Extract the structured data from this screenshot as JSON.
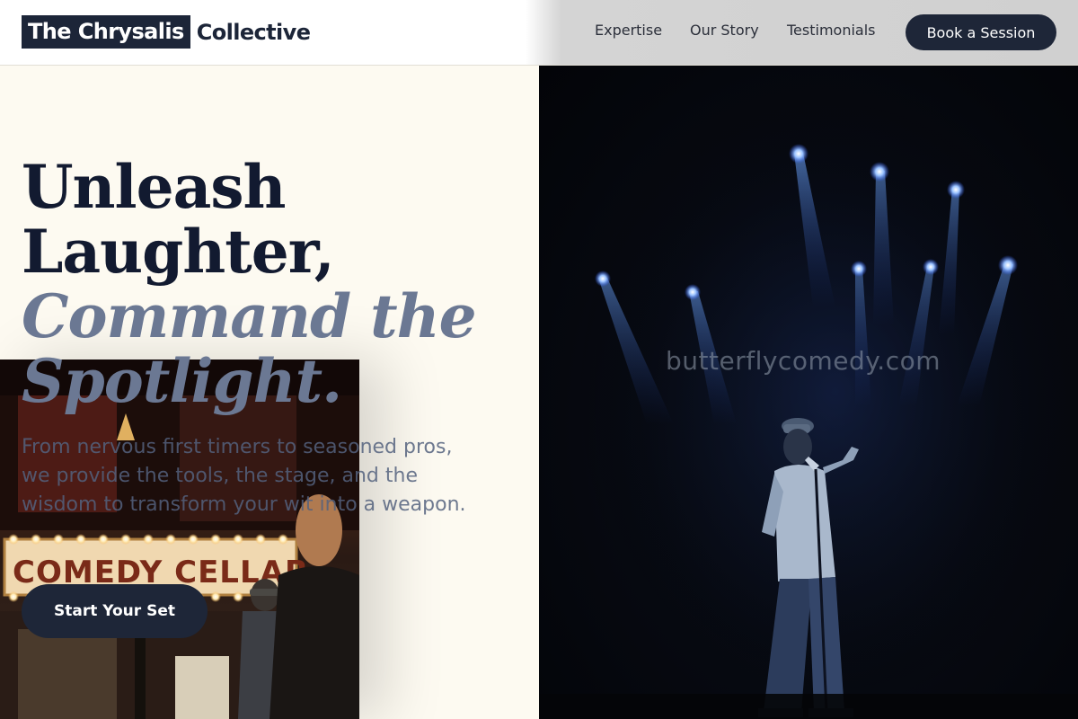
{
  "brand": {
    "name_boxed": "The Chrysalis",
    "name_rest": "Collective"
  },
  "nav": {
    "links": [
      "Expertise",
      "Our Story",
      "Testimonials"
    ],
    "cta": "Book a Session"
  },
  "hero": {
    "headline_line1": "Unleash",
    "headline_line2": "Laughter,",
    "headline_accent_line1": "Command the",
    "headline_accent_line2": "Spotlight.",
    "subtext": "From nervous first timers to seasoned pros, we provide the tools, the stage, and the wisdom to transform your wit into a weapon.",
    "cta": "Start Your Set"
  },
  "images": {
    "stage_photo": "comedian-on-stage-under-blue-spotlights",
    "venue_photo": "comedy-cellar-marquee-sign",
    "venue_sign_text": "COMEDY CELLAR",
    "watermark": "butterflycomedy.com"
  },
  "colors": {
    "navy": "#1e2638",
    "accent_slate": "#6b7893",
    "cream": "#fdfaf1"
  }
}
